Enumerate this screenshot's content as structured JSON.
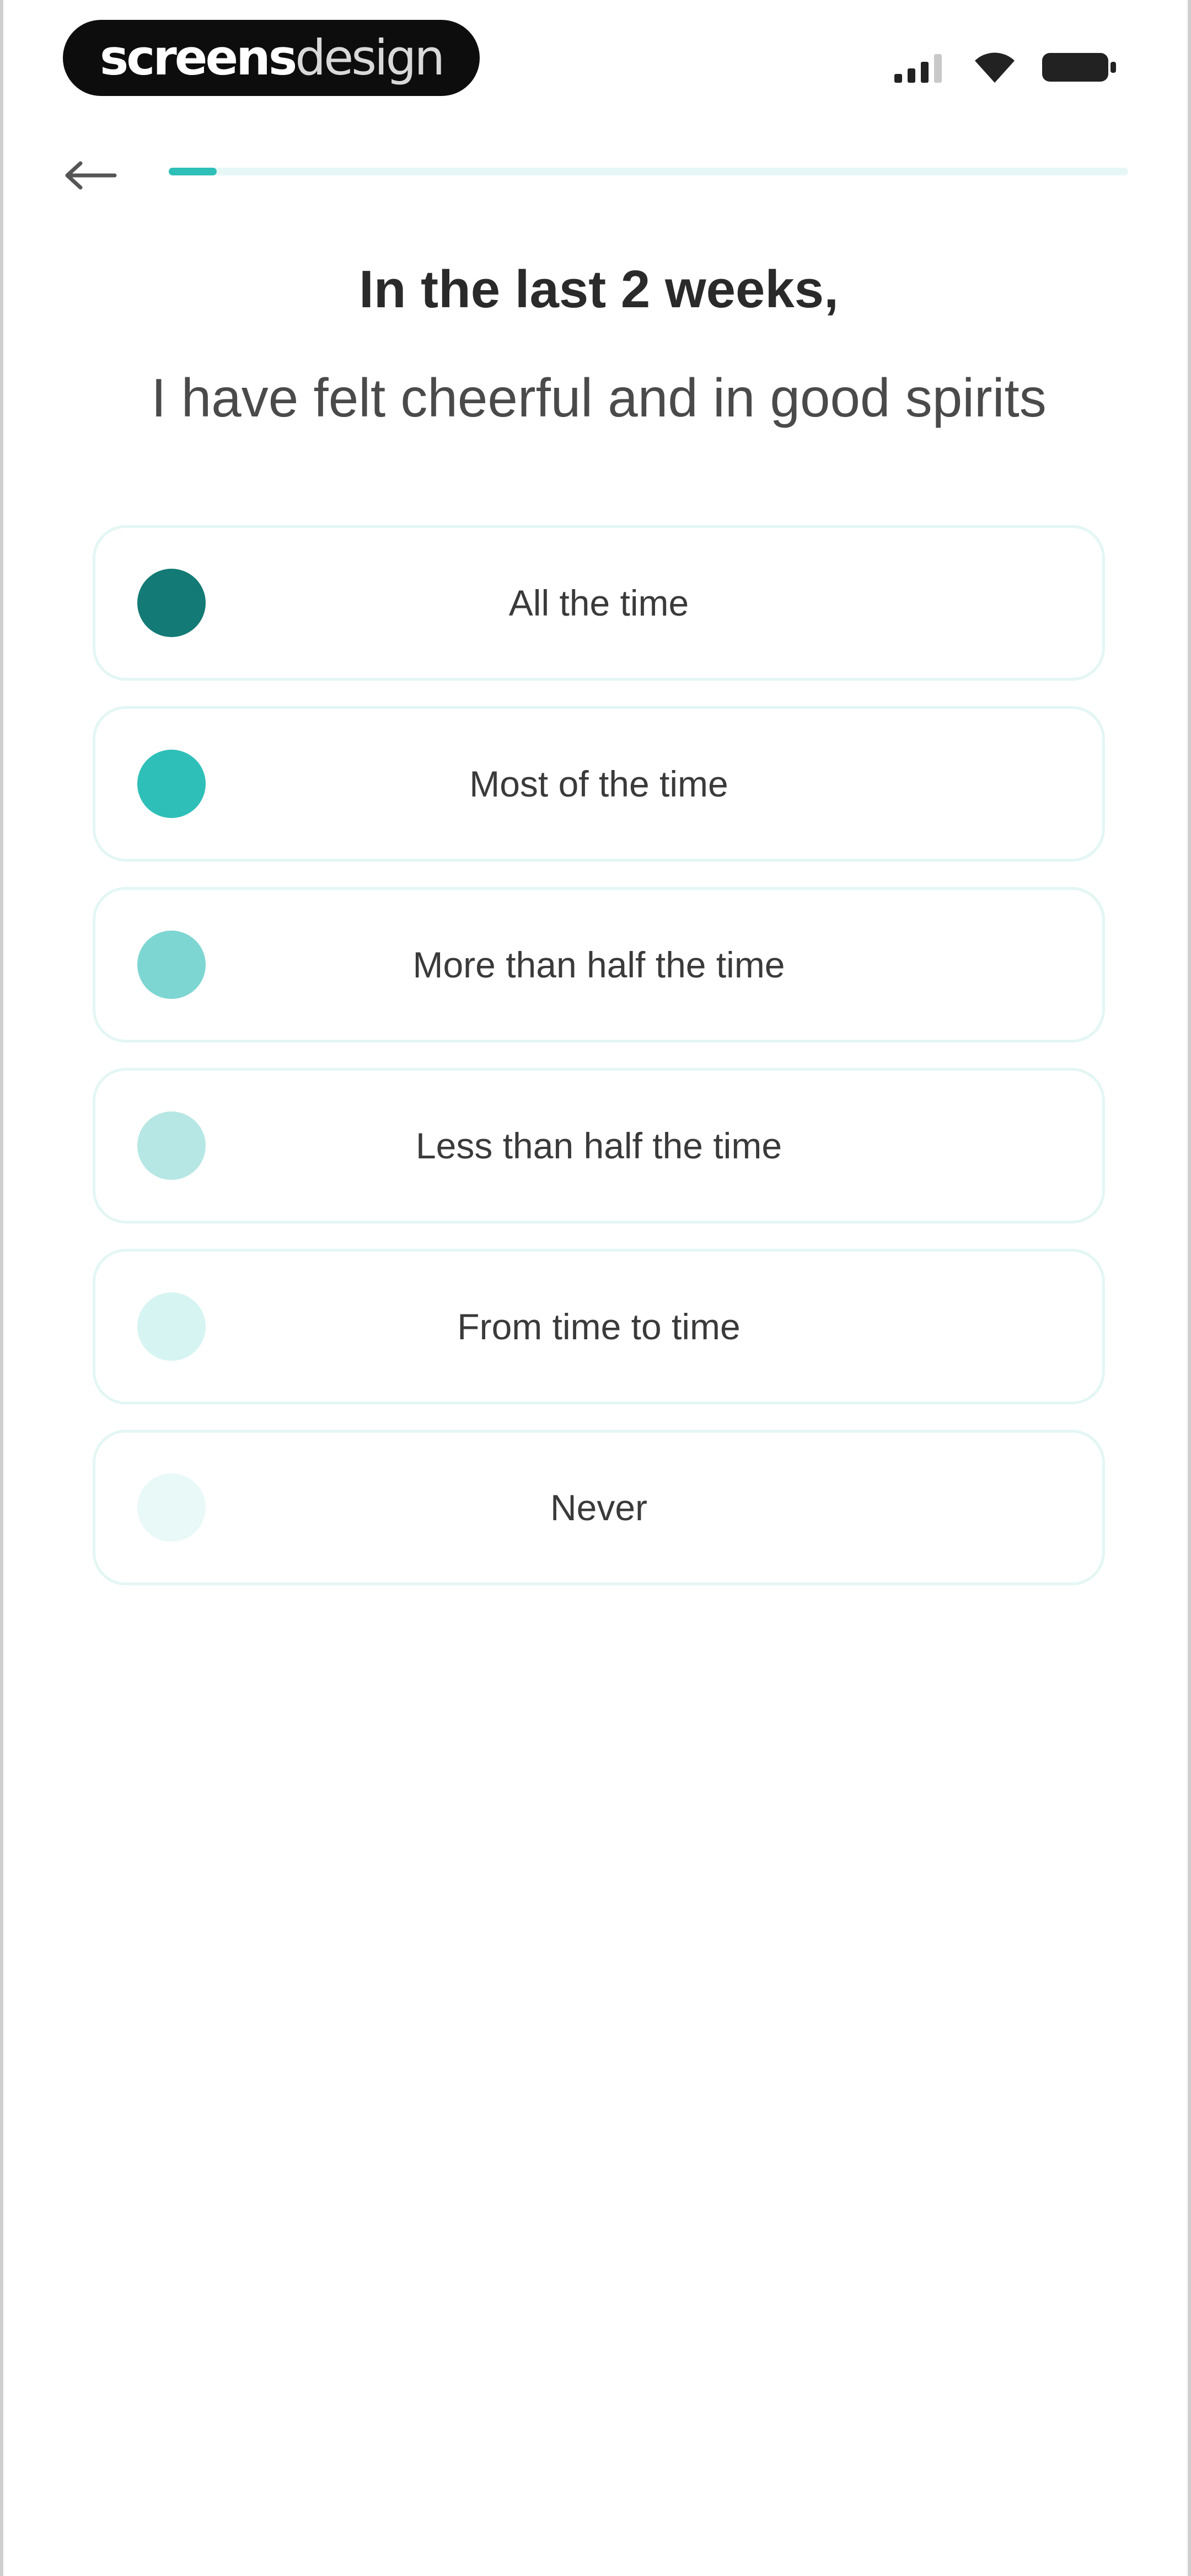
{
  "status_bar": {
    "brand_part1": "screens",
    "brand_part2": "design",
    "icons": [
      "signal-icon",
      "wifi-icon",
      "battery-icon"
    ]
  },
  "nav": {
    "back_icon": "arrow-left-icon",
    "progress_fraction": 0.05
  },
  "question": {
    "header": "In the last 2 weeks,",
    "statement": "I have felt cheerful and in good spirits"
  },
  "options": [
    {
      "label": "All the time",
      "color": "#137a75"
    },
    {
      "label": "Most of the time",
      "color": "#2ebfb8"
    },
    {
      "label": "More than half the time",
      "color": "#7dd6d1"
    },
    {
      "label": "Less than half the time",
      "color": "#b6e7e4"
    },
    {
      "label": "From time to time",
      "color": "#d6f4f2"
    },
    {
      "label": "Never",
      "color": "#e9f9f8"
    }
  ],
  "colors": {
    "accent": "#2ebfb8",
    "progress_track": "#e6f7f6",
    "card_border": "#e3f6f4"
  }
}
